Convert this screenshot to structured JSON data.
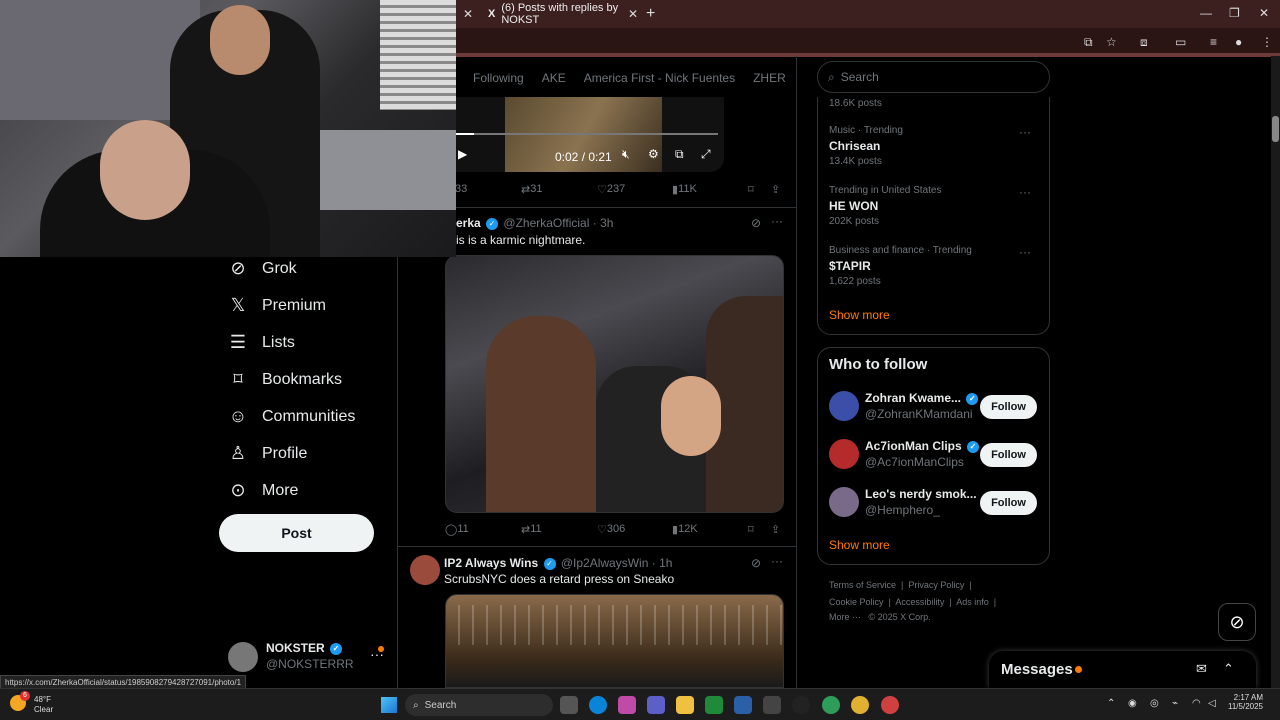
{
  "browser": {
    "tab_title": "(6) Posts with replies by NOKST",
    "tab_icon": "X",
    "status_url": "https://x.com/ZherkaOfficial/status/1985908279428727091/photo/1"
  },
  "nav": {
    "items": [
      {
        "label": "Grok",
        "icon": "grok-icon"
      },
      {
        "label": "Premium",
        "icon": "x-logo-icon"
      },
      {
        "label": "Lists",
        "icon": "list-icon"
      },
      {
        "label": "Bookmarks",
        "icon": "bookmark-icon"
      },
      {
        "label": "Communities",
        "icon": "people-icon"
      },
      {
        "label": "Profile",
        "icon": "person-icon"
      },
      {
        "label": "More",
        "icon": "more-circle-icon"
      }
    ],
    "post_label": "Post",
    "account": {
      "name": "NOKSTER",
      "handle": "@NOKSTERRR"
    }
  },
  "top_tabs": [
    "Following",
    "AKE",
    "America First - Nick Fuentes",
    "ZHER"
  ],
  "video": {
    "time": "0:02 / 0:21"
  },
  "feed": {
    "first_actions": {
      "replies": "33",
      "reposts": "31",
      "likes": "237",
      "views": "11K"
    },
    "tweet1": {
      "name": "erka",
      "handle": "@ZherkaOfficial",
      "age": "· 3h",
      "text": "is is a karmic nightmare.",
      "actions": {
        "replies": "11",
        "reposts": "11",
        "likes": "306",
        "views": "12K"
      }
    },
    "tweet2": {
      "name": "IP2 Always Wins",
      "handle": "@Ip2AlwaysWin",
      "age": "· 1h",
      "text": "ScrubsNYC does a retard press on Sneako"
    }
  },
  "search": {
    "placeholder": "Search"
  },
  "trends": {
    "top_count": "18.6K posts",
    "items": [
      {
        "category": "Music · Trending",
        "title": "Chrisean",
        "count": "13.4K posts"
      },
      {
        "category": "Trending in United States",
        "title": "HE WON",
        "count": "202K posts"
      },
      {
        "category": "Business and finance · Trending",
        "title": "$TAPIR",
        "count": "1,622 posts"
      }
    ],
    "show_more": "Show more"
  },
  "who_to_follow": {
    "title": "Who to follow",
    "items": [
      {
        "name": "Zohran Kwame...",
        "handle": "@ZohranKMamdani",
        "color": "#3b4fa8"
      },
      {
        "name": "Ac7ionMan Clips",
        "handle": "@Ac7ionManClips",
        "color": "#b52a2a"
      },
      {
        "name": "Leo's nerdy smok...",
        "handle": "@Hemphero_",
        "color": "#7a6a8a"
      }
    ],
    "follow_label": "Follow",
    "show_more": "Show more"
  },
  "footer": {
    "line1": [
      "Terms of Service",
      "Privacy Policy"
    ],
    "line2": [
      "Cookie Policy",
      "Accessibility",
      "Ads info"
    ],
    "more": "More ···",
    "copyright": "© 2025 X Corp."
  },
  "messages": {
    "label": "Messages"
  },
  "taskbar": {
    "weather_temp": "48°F",
    "weather_desc": "Clear",
    "badge": "6",
    "search_label": "Search",
    "time": "2:17 AM",
    "date": "11/5/2025"
  }
}
